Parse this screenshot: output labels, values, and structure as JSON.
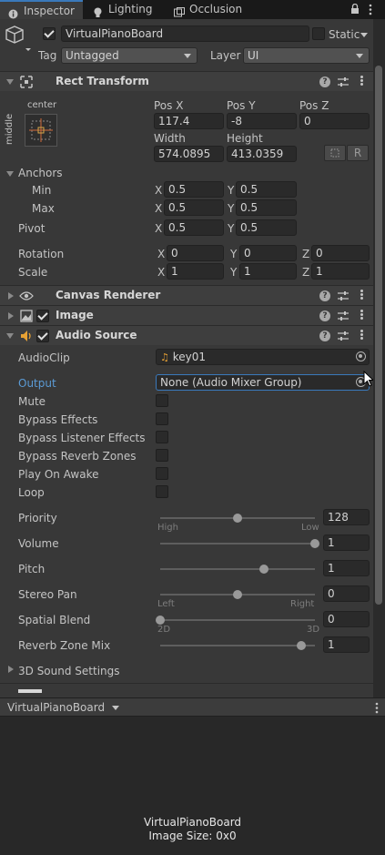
{
  "tabs": [
    {
      "label": "Inspector",
      "icon": "info-icon"
    },
    {
      "label": "Lighting",
      "icon": "light-bulb-icon"
    },
    {
      "label": "Occlusion",
      "icon": "occlusion-icon"
    }
  ],
  "object": {
    "name": "VirtualPianoBoard",
    "active": true,
    "static_label": "Static",
    "tag_label": "Tag",
    "tag_value": "Untagged",
    "layer_label": "Layer",
    "layer_value": "UI"
  },
  "rect_transform": {
    "title": "Rect Transform",
    "anchor_preset_top": "center",
    "anchor_preset_side": "middle",
    "pos_x_label": "Pos X",
    "pos_y_label": "Pos Y",
    "pos_z_label": "Pos Z",
    "pos_x": "117.4",
    "pos_y": "-8",
    "pos_z": "0",
    "width_label": "Width",
    "height_label": "Height",
    "width": "574.0895",
    "height": "413.0359",
    "r_button": "R",
    "anchors_label": "Anchors",
    "min_label": "Min",
    "max_label": "Max",
    "min_x": "0.5",
    "min_y": "0.5",
    "max_x": "0.5",
    "max_y": "0.5",
    "pivot_label": "Pivot",
    "pivot_x": "0.5",
    "pivot_y": "0.5",
    "rotation_label": "Rotation",
    "rot_x": "0",
    "rot_y": "0",
    "rot_z": "0",
    "scale_label": "Scale",
    "scale_x": "1",
    "scale_y": "1",
    "scale_z": "1",
    "x": "X",
    "y": "Y",
    "z": "Z"
  },
  "canvas_renderer": {
    "title": "Canvas Renderer"
  },
  "image": {
    "title": "Image",
    "enabled": true
  },
  "audio_source": {
    "title": "Audio Source",
    "enabled": true,
    "audioclip_label": "AudioClip",
    "audioclip_value": "key01",
    "output_label": "Output",
    "output_value": "None (Audio Mixer Group)",
    "toggles": [
      {
        "label": "Mute",
        "checked": false
      },
      {
        "label": "Bypass Effects",
        "checked": false
      },
      {
        "label": "Bypass Listener Effects",
        "checked": false
      },
      {
        "label": "Bypass Reverb Zones",
        "checked": false
      },
      {
        "label": "Play On Awake",
        "checked": false
      },
      {
        "label": "Loop",
        "checked": false
      }
    ],
    "sliders": [
      {
        "label": "Priority",
        "value": "128",
        "fraction": 0.5,
        "left_hint": "High",
        "right_hint": "Low"
      },
      {
        "label": "Volume",
        "value": "1",
        "fraction": 1.0,
        "left_hint": "",
        "right_hint": ""
      },
      {
        "label": "Pitch",
        "value": "1",
        "fraction": 0.67,
        "left_hint": "",
        "right_hint": ""
      },
      {
        "label": "Stereo Pan",
        "value": "0",
        "fraction": 0.5,
        "left_hint": "Left",
        "right_hint": "Right"
      },
      {
        "label": "Spatial Blend",
        "value": "0",
        "fraction": 0.0,
        "left_hint": "2D",
        "right_hint": "3D"
      },
      {
        "label": "Reverb Zone Mix",
        "value": "1",
        "fraction": 0.91,
        "left_hint": "",
        "right_hint": ""
      }
    ],
    "sound_settings_label": "3D Sound Settings"
  },
  "preview": {
    "dropdown_label": "VirtualPianoBoard",
    "name": "VirtualPianoBoard",
    "image_size": "Image Size: 0x0"
  },
  "colors": {
    "accent": "#3a79bb",
    "output_label": "#5b9bd5",
    "panel": "#383838"
  }
}
